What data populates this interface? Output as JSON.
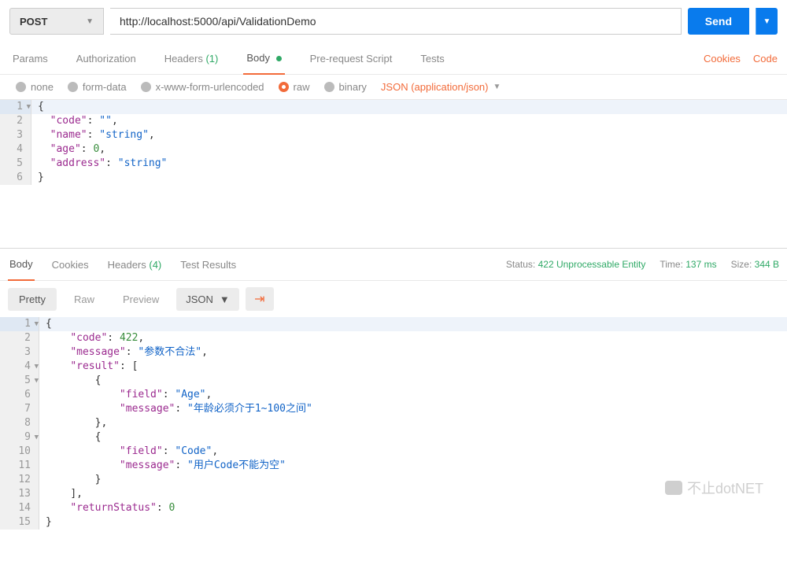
{
  "request": {
    "method": "POST",
    "url": "http://localhost:5000/api/ValidationDemo",
    "send_label": "Send"
  },
  "req_tabs": {
    "params": "Params",
    "auth": "Authorization",
    "headers": "Headers",
    "headers_count": "(1)",
    "body": "Body",
    "prereq": "Pre-request Script",
    "tests": "Tests"
  },
  "right_links": {
    "cookies": "Cookies",
    "code": "Code"
  },
  "body_types": {
    "none": "none",
    "formdata": "form-data",
    "urlencoded": "x-www-form-urlencoded",
    "raw": "raw",
    "binary": "binary",
    "content_type": "JSON (application/json)"
  },
  "request_body": {
    "l1": "{",
    "l2a": "\"code\"",
    "l2b": ": ",
    "l2c": "\"\"",
    "l2d": ",",
    "l3a": "\"name\"",
    "l3b": ": ",
    "l3c": "\"string\"",
    "l3d": ",",
    "l4a": "\"age\"",
    "l4b": ": ",
    "l4c": "0",
    "l4d": ",",
    "l5a": "\"address\"",
    "l5b": ": ",
    "l5c": "\"string\"",
    "l6": "}"
  },
  "resp_tabs": {
    "body": "Body",
    "cookies": "Cookies",
    "headers": "Headers",
    "headers_count": "(4)",
    "tests": "Test Results"
  },
  "resp_meta": {
    "status_lbl": "Status:",
    "status_val": "422 Unprocessable Entity",
    "time_lbl": "Time:",
    "time_val": "137 ms",
    "size_lbl": "Size:",
    "size_val": "344 B"
  },
  "resp_toolbar": {
    "pretty": "Pretty",
    "raw": "Raw",
    "preview": "Preview",
    "format": "JSON"
  },
  "response_body": {
    "l1": "{",
    "l2a": "\"code\"",
    "l2b": ": ",
    "l2c": "422",
    "l2d": ",",
    "l3a": "\"message\"",
    "l3b": ": ",
    "l3c": "\"参数不合法\"",
    "l3d": ",",
    "l4a": "\"result\"",
    "l4b": ": [",
    "l5": "{",
    "l6a": "\"field\"",
    "l6b": ": ",
    "l6c": "\"Age\"",
    "l6d": ",",
    "l7a": "\"message\"",
    "l7b": ": ",
    "l7c": "\"年龄必须介于1~100之间\"",
    "l8": "},",
    "l9": "{",
    "l10a": "\"field\"",
    "l10b": ": ",
    "l10c": "\"Code\"",
    "l10d": ",",
    "l11a": "\"message\"",
    "l11b": ": ",
    "l11c": "\"用户Code不能为空\"",
    "l12": "}",
    "l13": "],",
    "l14a": "\"returnStatus\"",
    "l14b": ": ",
    "l14c": "0",
    "l15": "}"
  },
  "watermark": "不止dotNET",
  "line_nums": {
    "n1": "1",
    "n2": "2",
    "n3": "3",
    "n4": "4",
    "n5": "5",
    "n6": "6",
    "n7": "7",
    "n8": "8",
    "n9": "9",
    "n10": "10",
    "n11": "11",
    "n12": "12",
    "n13": "13",
    "n14": "14",
    "n15": "15"
  }
}
